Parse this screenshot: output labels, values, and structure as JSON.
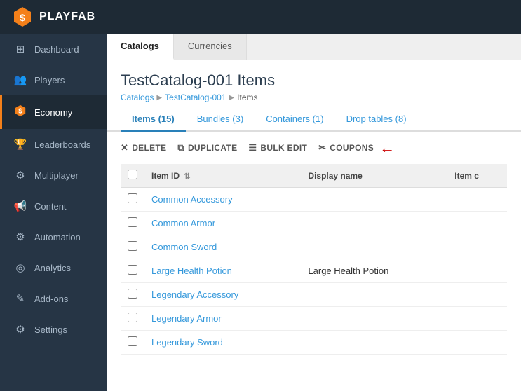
{
  "brand": {
    "name": "PLAYFAB"
  },
  "sidebar": {
    "items": [
      {
        "id": "dashboard",
        "label": "Dashboard",
        "icon": "⊞"
      },
      {
        "id": "players",
        "label": "Players",
        "icon": "👥"
      },
      {
        "id": "economy",
        "label": "Economy",
        "icon": "💲",
        "active": true
      },
      {
        "id": "leaderboards",
        "label": "Leaderboards",
        "icon": "🏆"
      },
      {
        "id": "multiplayer",
        "label": "Multiplayer",
        "icon": "⚙"
      },
      {
        "id": "content",
        "label": "Content",
        "icon": "📢"
      },
      {
        "id": "automation",
        "label": "Automation",
        "icon": "⚙"
      },
      {
        "id": "analytics",
        "label": "Analytics",
        "icon": "◎"
      },
      {
        "id": "addons",
        "label": "Add-ons",
        "icon": "✎"
      },
      {
        "id": "settings",
        "label": "Settings",
        "icon": "⚙"
      }
    ]
  },
  "tabs": [
    {
      "id": "catalogs",
      "label": "Catalogs",
      "active": true
    },
    {
      "id": "currencies",
      "label": "Currencies",
      "active": false
    }
  ],
  "page": {
    "title": "TestCatalog-001 Items",
    "breadcrumb": [
      {
        "label": "Catalogs",
        "link": true
      },
      {
        "label": "TestCatalog-001",
        "link": true
      },
      {
        "label": "Items",
        "link": false
      }
    ]
  },
  "sub_tabs": [
    {
      "id": "items",
      "label": "Items (15)",
      "active": true
    },
    {
      "id": "bundles",
      "label": "Bundles (3)",
      "active": false
    },
    {
      "id": "containers",
      "label": "Containers (1)",
      "active": false
    },
    {
      "id": "droptables",
      "label": "Drop tables (8)",
      "active": false
    }
  ],
  "toolbar": {
    "delete_label": "DELETE",
    "duplicate_label": "DUPLICATE",
    "bulk_edit_label": "BULK EDIT",
    "coupons_label": "COUPONS"
  },
  "table": {
    "columns": [
      {
        "id": "checkbox",
        "label": ""
      },
      {
        "id": "item_id",
        "label": "Item ID",
        "sortable": true
      },
      {
        "id": "display_name",
        "label": "Display name"
      },
      {
        "id": "item_class",
        "label": "Item c"
      }
    ],
    "rows": [
      {
        "item_id": "Common Accessory",
        "display_name": "",
        "item_class": ""
      },
      {
        "item_id": "Common Armor",
        "display_name": "",
        "item_class": ""
      },
      {
        "item_id": "Common Sword",
        "display_name": "",
        "item_class": ""
      },
      {
        "item_id": "Large Health Potion",
        "display_name": "Large Health Potion",
        "item_class": ""
      },
      {
        "item_id": "Legendary Accessory",
        "display_name": "",
        "item_class": ""
      },
      {
        "item_id": "Legendary Armor",
        "display_name": "",
        "item_class": ""
      },
      {
        "item_id": "Legendary Sword",
        "display_name": "",
        "item_class": ""
      }
    ]
  }
}
